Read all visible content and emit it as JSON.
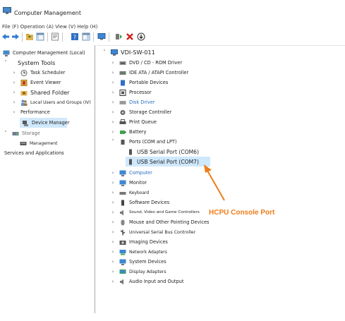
{
  "window": {
    "title": "Computer Management"
  },
  "menu": {
    "label": "File (F) Operation (A) View (V) Help (H)"
  },
  "toolbar": {
    "buttons": [
      "back-arrow-icon",
      "forward-arrow-icon",
      "folder-up-icon",
      "console-tree-icon",
      "properties-icon",
      "help-icon",
      "show-hide-icon",
      "monitor-icon",
      "update-driver-icon",
      "delete-icon",
      "download-icon"
    ]
  },
  "left_tree": {
    "root": "Computer Management (Local)",
    "system_tools": "System Tools",
    "task_scheduler": "Task Scheduler",
    "event_viewer": "Event Viewer",
    "shared_folder": "Shared Folder",
    "local_users": "Local Users and Groups (IV)",
    "performance": "Performance",
    "device_manager": "Device Manager",
    "storage": "Storage",
    "management": "Management",
    "services": "Services and Applications"
  },
  "right_tree": {
    "computer": "VDI-SW-011",
    "categories": [
      "DVD / CD - ROM Driver",
      "IDE ATA / ATAPI Controller",
      "Portable Devices",
      "Processor",
      "Disk Driver",
      "Storage Controller",
      "Print Queue",
      "Battery",
      "Ports (COM and LPT)",
      "USB Serial Port (COM6)",
      "USB Serial Port (COM7)",
      "Computer",
      "Monitor",
      "Keyboard",
      "Software Devices",
      "Sound, Video and Game Controllers",
      "Mouse and Other Pointing Devices",
      "Universal Serial Bus Controller",
      "Imaging Devices",
      "Network Adapters",
      "System Devices",
      "Display Adapters",
      "Audio Input and Output"
    ]
  },
  "annotation": {
    "label": "HCPU Console Port",
    "color": "#ef7d18"
  }
}
